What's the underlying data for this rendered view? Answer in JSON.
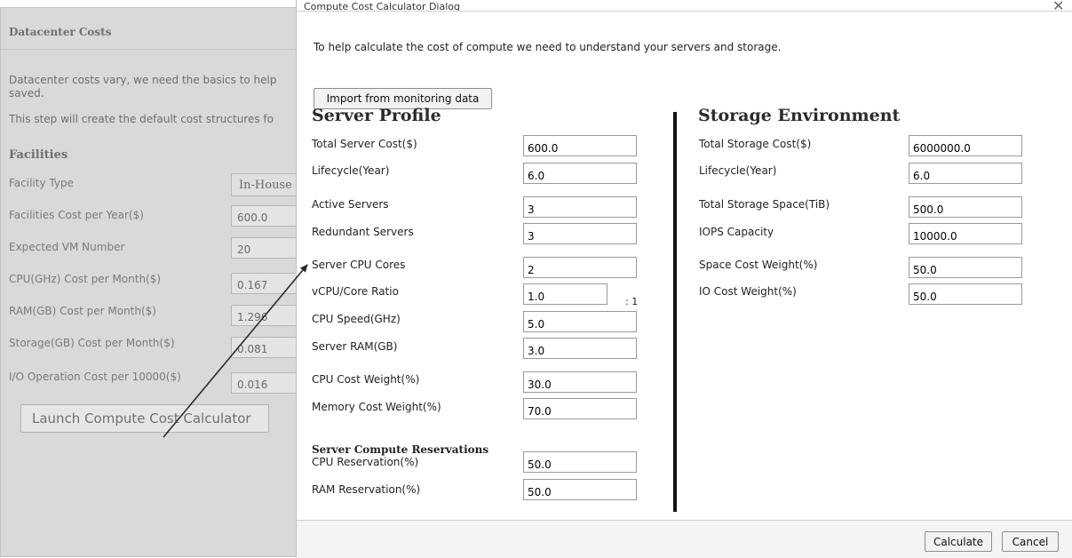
{
  "background_page": {
    "title": "Datacenter Costs",
    "desc_line1": "Datacenter costs vary, we need the basics to help",
    "desc_line2": "saved.",
    "desc_line3": "This step will create the default cost structures fo",
    "facilities_heading": "Facilities",
    "fields": [
      {
        "label": "Facility Type",
        "value": "In-House"
      },
      {
        "label": "Facilities Cost per Year($)",
        "value": "600.0"
      },
      {
        "label": "Expected VM Number",
        "value": "20"
      },
      {
        "label": "CPU(GHz) Cost per Month($)",
        "value": "0.167"
      },
      {
        "label": "RAM(GB) Cost per Month($)",
        "value": "1.296"
      },
      {
        "label": "Storage(GB) Cost per Month($)",
        "value": "0.081"
      },
      {
        "label": "I/O Operation Cost per 10000($)",
        "value": "0.016"
      }
    ],
    "launch_button": "Launch Compute Cost Calculator"
  },
  "dialog": {
    "title": "Compute Cost Calculator Dialog",
    "close_glyph": "✕",
    "intro": "To help calculate the cost of compute we need to understand your servers and storage.",
    "import_button": "Import from monitoring data",
    "server": {
      "heading": "Server Profile",
      "fields": [
        {
          "label": "Total Server Cost($)",
          "value": "600.0"
        },
        {
          "label": "Lifecycle(Year)",
          "value": "6.0"
        },
        {
          "label": "Active Servers",
          "value": "3"
        },
        {
          "label": "Redundant Servers",
          "value": "3"
        },
        {
          "label": "Server CPU Cores",
          "value": "2"
        },
        {
          "label": "vCPU/Core Ratio",
          "value": "1.0"
        },
        {
          "label": "CPU Speed(GHz)",
          "value": "5.0"
        },
        {
          "label": "Server RAM(GB)",
          "value": "3.0"
        },
        {
          "label": "CPU Cost Weight(%)",
          "value": "30.0"
        },
        {
          "label": "Memory Cost Weight(%)",
          "value": "70.0"
        }
      ],
      "ratio_suffix": ": 1",
      "reservations_heading": "Server Compute Reservations",
      "reservations": [
        {
          "label": "CPU Reservation(%)",
          "value": "50.0"
        },
        {
          "label": "RAM Reservation(%)",
          "value": "50.0"
        }
      ]
    },
    "storage": {
      "heading": "Storage Environment",
      "fields": [
        {
          "label": "Total Storage Cost($)",
          "value": "6000000.0"
        },
        {
          "label": "Lifecycle(Year)",
          "value": "6.0"
        },
        {
          "label": "Total Storage Space(TiB)",
          "value": "500.0"
        },
        {
          "label": "IOPS Capacity",
          "value": "10000.0"
        },
        {
          "label": "Space Cost Weight(%)",
          "value": "50.0"
        },
        {
          "label": "IO Cost Weight(%)",
          "value": "50.0"
        }
      ]
    },
    "calculate_button": "Calculate",
    "cancel_button": "Cancel"
  },
  "colors": {
    "overlay_grey": "#d9d9d9",
    "arrow": "#2b2b2b",
    "divider": "#111111"
  }
}
